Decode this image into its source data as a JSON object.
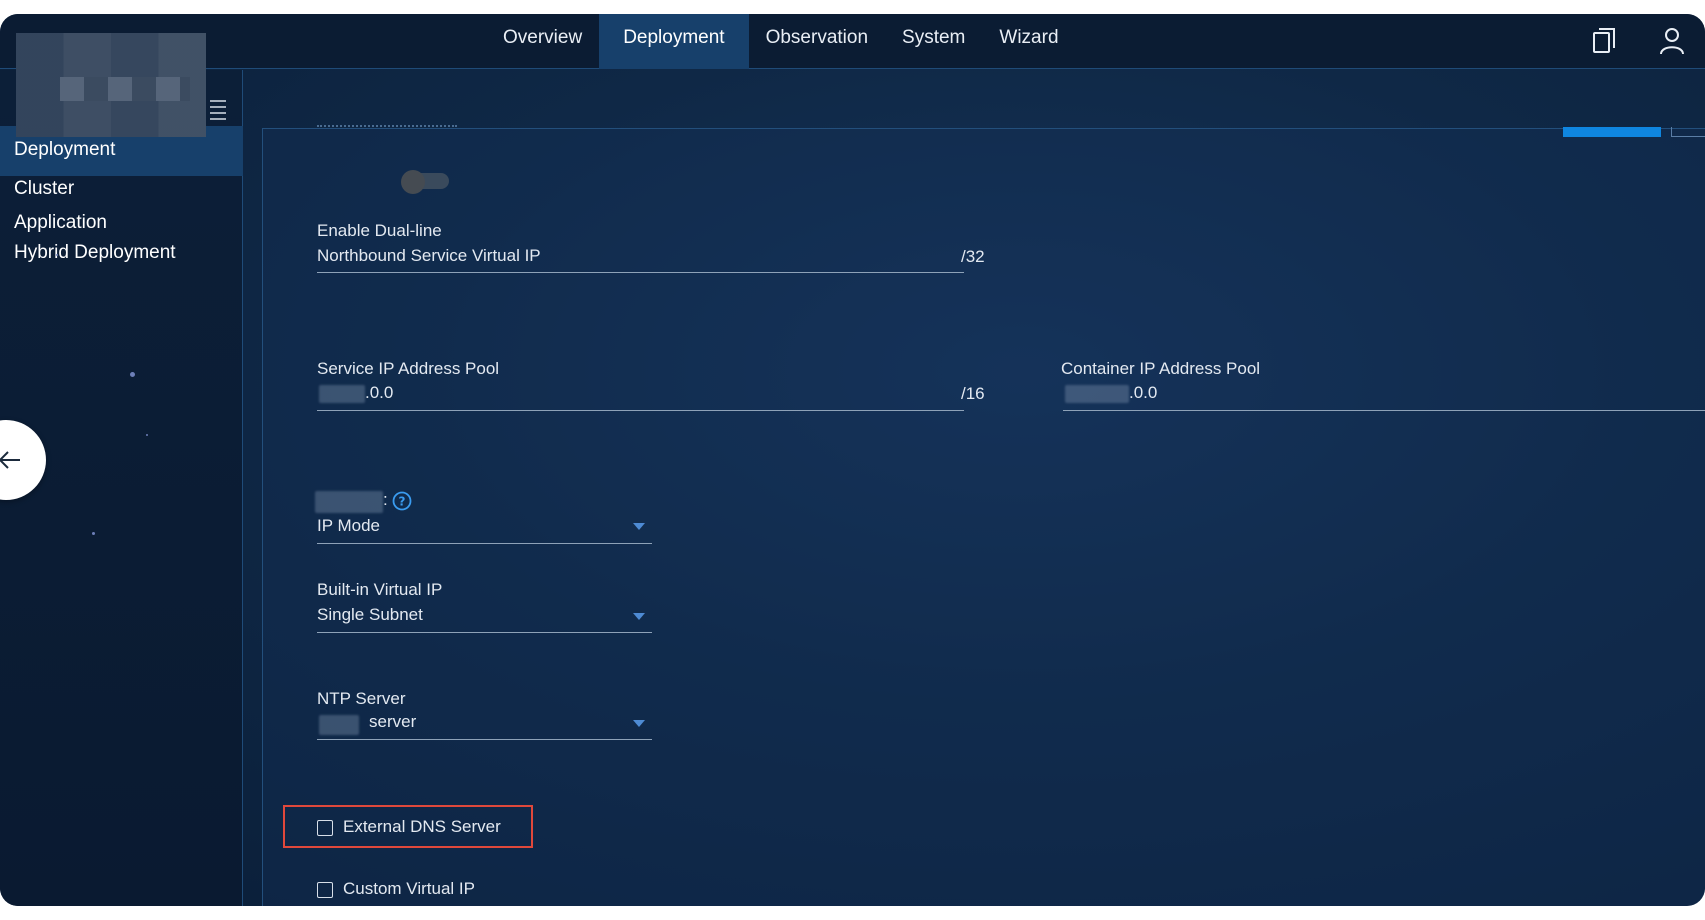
{
  "nav": {
    "items": [
      "Overview",
      "Deployment",
      "Observation",
      "System",
      "Wizard"
    ],
    "active_index": 1
  },
  "icons": {
    "clipboard": "clipboard-icon",
    "user": "user-icon",
    "menu": "hamburger-menu-icon",
    "back": "arrow-left-icon",
    "help": "question-circle-icon",
    "dropdown": "caret-down-icon"
  },
  "sidebar": {
    "items": [
      "Deployment",
      "Cluster",
      "Application",
      "Hybrid Deployment"
    ],
    "active_index": 0
  },
  "form": {
    "dual_line": {
      "label": "Enable Dual-line",
      "value": "Northbound Service Virtual IP",
      "suffix": "/32",
      "enabled": false
    },
    "service_pool": {
      "label": "Service IP Address Pool",
      "value": ".0.0",
      "suffix": "/16"
    },
    "container_pool": {
      "label": "Container IP Address Pool",
      "value": ".0.0"
    },
    "ip_mode": {
      "label": ":",
      "value": "IP Mode"
    },
    "builtin_vip": {
      "label": "Built-in Virtual IP",
      "value": "Single Subnet"
    },
    "ntp": {
      "label": "NTP Server",
      "value": "server"
    },
    "external_dns": {
      "label": "External DNS Server",
      "checked": false
    },
    "custom_vip": {
      "label": "Custom Virtual IP",
      "checked": false
    }
  },
  "colors": {
    "accent": "#0f86e0",
    "active_bg": "#17406b",
    "highlight": "#e0483b",
    "caret": "#4e8bd4"
  }
}
